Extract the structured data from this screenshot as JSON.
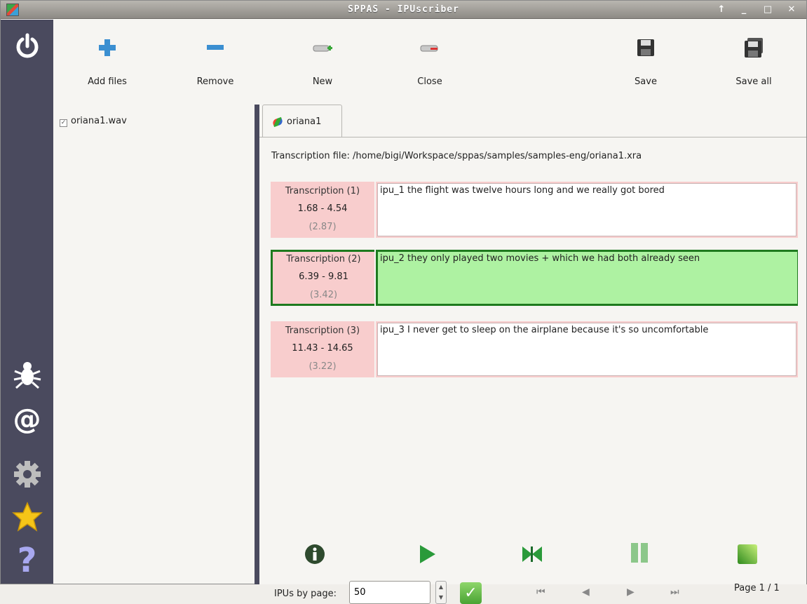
{
  "window": {
    "title": "SPPAS - IPUscriber",
    "controls": [
      "↑",
      "_",
      "□",
      "✕"
    ]
  },
  "sidebar": {
    "icons": [
      "power-icon",
      "bug-icon",
      "at-icon",
      "gear-icon",
      "star-icon",
      "help-icon"
    ]
  },
  "toolbar": {
    "add_files": "Add files",
    "remove": "Remove",
    "new": "New",
    "close": "Close",
    "save": "Save",
    "save_all": "Save all"
  },
  "file_tree": {
    "items": [
      {
        "label": "oriana1.wav",
        "checked": true
      }
    ]
  },
  "tab": {
    "label": "oriana1"
  },
  "transcription_file": "Transcription file: /home/bigi/Workspace/sppas/samples/samples-eng/oriana1.xra",
  "ipus": [
    {
      "title": "Transcription (1)",
      "range": "1.68 -  4.54",
      "duration": "(2.87)",
      "text": "ipu_1 the flight was twelve hours long and we really got bored",
      "active": false
    },
    {
      "title": "Transcription (2)",
      "range": "6.39 -  9.81",
      "duration": "(3.42)",
      "text": "ipu_2 they only played two movies + which we had both already seen",
      "active": true
    },
    {
      "title": "Transcription (3)",
      "range": "11.43 - 14.65",
      "duration": "(3.22)",
      "text": "ipu_3 I never get to sleep on the airplane because it's so uncomfortable",
      "active": false
    }
  ],
  "footer": {
    "ipus_by_page_label": "IPUs by page:",
    "ipus_by_page_value": "50",
    "page_label": "Page 1 / 1",
    "nav": [
      "⏮",
      "◀",
      "▶",
      "⏭"
    ]
  },
  "colors": {
    "sidebar_bg": "#4a4a5e",
    "ipu_bg": "#f8cdcd",
    "active_border": "#1e7a1e",
    "active_text_bg": "#aef2a2"
  }
}
